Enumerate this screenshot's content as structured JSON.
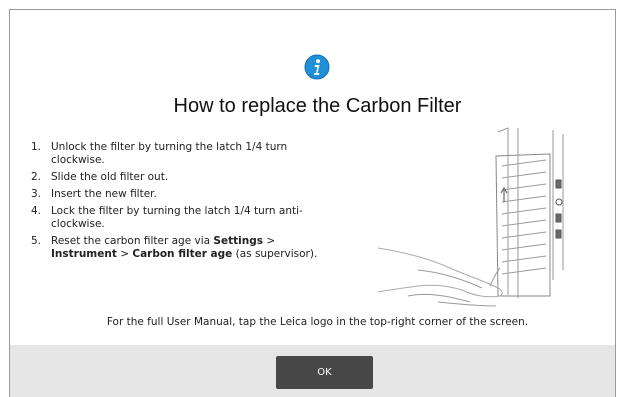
{
  "dialog": {
    "title": "How to replace the Carbon Filter",
    "steps": [
      {
        "num": "1.",
        "text": "Unlock the filter by turning the latch 1/4 turn clockwise."
      },
      {
        "num": "2.",
        "text": "Slide the old filter out."
      },
      {
        "num": "3.",
        "text": "Insert the new filter."
      },
      {
        "num": "4.",
        "text": "Lock the filter by turning the latch 1/4 turn anti-clockwise."
      },
      {
        "num": "5.",
        "pre": "Reset the carbon filter age via ",
        "b1": "Settings",
        "sep1": " > ",
        "b2": "Instrument",
        "sep2": " > ",
        "b3": "Carbon filter age",
        "post": " (as supervisor)."
      }
    ],
    "footer_note": "For the full User Manual, tap the Leica logo in the top-right corner of the screen.",
    "ok_label": "OK"
  },
  "icons": {
    "info": "info-icon",
    "illustration": "carbon-filter-illustration"
  },
  "colors": {
    "info_blue": "#1f8fd6",
    "button": "#474747",
    "footer_bar": "#e6e6e6"
  }
}
